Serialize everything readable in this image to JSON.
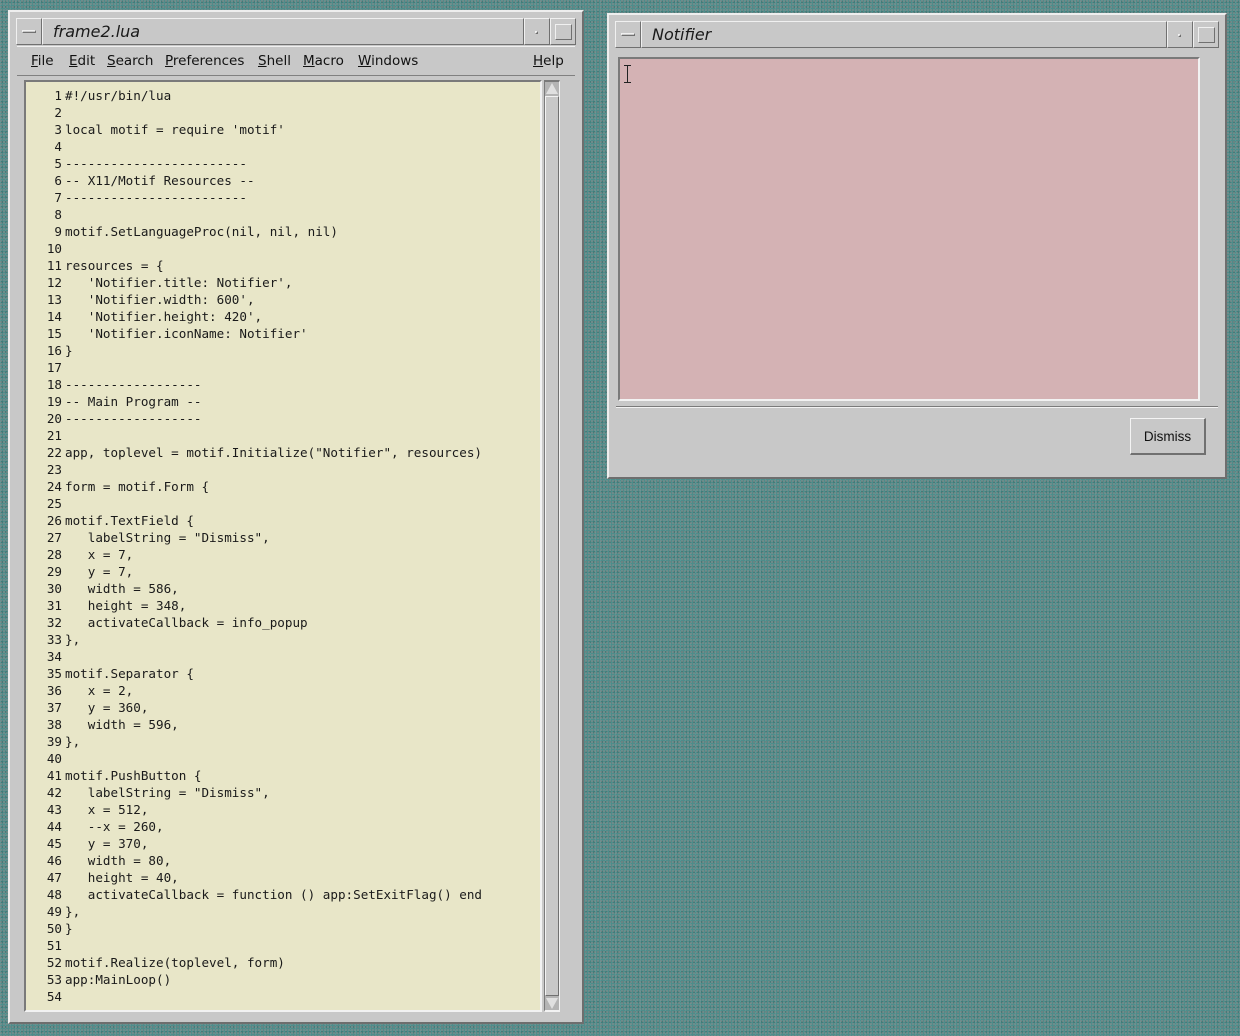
{
  "editor": {
    "title": "frame2.lua",
    "menu": [
      {
        "underline": "F",
        "rest": "ile"
      },
      {
        "underline": "E",
        "rest": "dit"
      },
      {
        "underline": "S",
        "rest": "earch"
      },
      {
        "underline": "P",
        "rest": "references"
      },
      {
        "underline": "S",
        "rest": "hell",
        "pre": ""
      },
      {
        "pre": "",
        "underline": "M",
        "rest": "acro"
      },
      {
        "underline": "W",
        "rest": "indows"
      },
      {
        "underline": "H",
        "rest": "elp"
      }
    ],
    "lines": [
      "#!/usr/bin/lua",
      "",
      "local motif = require 'motif'",
      "",
      "------------------------",
      "-- X11/Motif Resources --",
      "------------------------",
      "",
      "motif.SetLanguageProc(nil, nil, nil)",
      "",
      "resources = {",
      "   'Notifier.title: Notifier',",
      "   'Notifier.width: 600',",
      "   'Notifier.height: 420',",
      "   'Notifier.iconName: Notifier'",
      "}",
      "",
      "------------------",
      "-- Main Program --",
      "------------------",
      "",
      "app, toplevel = motif.Initialize(\"Notifier\", resources)",
      "",
      "form = motif.Form {",
      "",
      "motif.TextField {",
      "   labelString = \"Dismiss\",",
      "   x = 7,",
      "   y = 7,",
      "   width = 586,",
      "   height = 348,",
      "   activateCallback = info_popup",
      "},",
      "",
      "motif.Separator {",
      "   x = 2,",
      "   y = 360,",
      "   width = 596,",
      "},",
      "",
      "motif.PushButton {",
      "   labelString = \"Dismiss\",",
      "   x = 512,",
      "   --x = 260,",
      "   y = 370,",
      "   width = 80,",
      "   height = 40,",
      "   activateCallback = function () app:SetExitFlag() end",
      "},",
      "}",
      "",
      "motif.Realize(toplevel, form)",
      "app:MainLoop()",
      ""
    ]
  },
  "notifier": {
    "title": "Notifier",
    "button_label": "Dismiss",
    "text_value": ""
  },
  "colors": {
    "desktop": "#4f8c8a",
    "editor_bg": "#e8e6c8",
    "textfield_bg": "#d4b2b4",
    "chrome": "#c8c8c8"
  }
}
